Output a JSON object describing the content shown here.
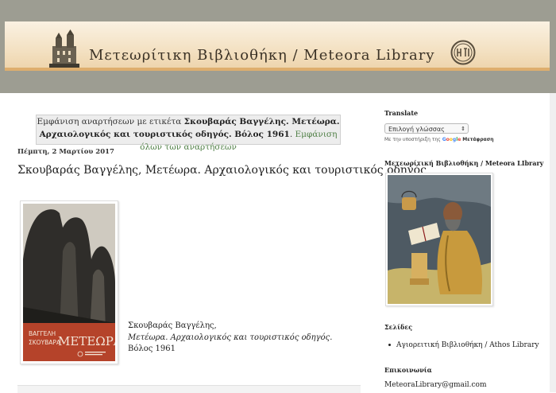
{
  "header": {
    "title": "Μετεωρίτικη Βιβλιοθήκη / Meteora Library"
  },
  "label_notice": {
    "prefix": "Εμφάνιση αναρτήσεων με ετικέτα ",
    "label": "Σκουβαράς Βαγγέλης. Μετέωρα. Αρχαιολογικός και τουριστικός οδηγός. Βόλος 1961",
    "suffix": ". ",
    "show_all": "Εμφάνιση όλων των αναρτήσεων"
  },
  "post": {
    "date": "Πέμπτη, 2 Μαρτίου 2017",
    "title": "Σκουβαράς Βαγγέλης, Μετέωρα. Αρχαιολογικός και τουριστικός οδηγός",
    "cover_author": "ΒΑΓΓΕΛΗ ΣΚΟΥΒΑΡΑ",
    "cover_title": "ΜΕΤΕΩΡΑ",
    "caption_line1": "Σκουβαράς Βαγγέλης,",
    "caption_line2": "Μετέωρα. Αρχαιολογικός και τουριστικός οδηγός.",
    "caption_line3": "Βόλος 1961"
  },
  "sidebar": {
    "translate_heading": "Translate",
    "language_select": "Επιλογή γλώσσας",
    "powered_by": "Με την υποστήριξη της ",
    "google": "Google",
    "translate_word": "Μετάφραση",
    "library_heading": "Μετεωρίτική Βιβλιοθήκη / Meteora LIbrary",
    "pages_heading": "Σελίδες",
    "pages": [
      "Αγιορειτική Βιβλιοθήκη / Athos Library"
    ],
    "contact_heading": "Επικοινωνία",
    "email": "MeteoraLibrary@gmail.com"
  },
  "colors": {
    "frame_grey": "#9d9d92",
    "link_green": "#4f7f45",
    "cover_red": "#b5432a"
  }
}
